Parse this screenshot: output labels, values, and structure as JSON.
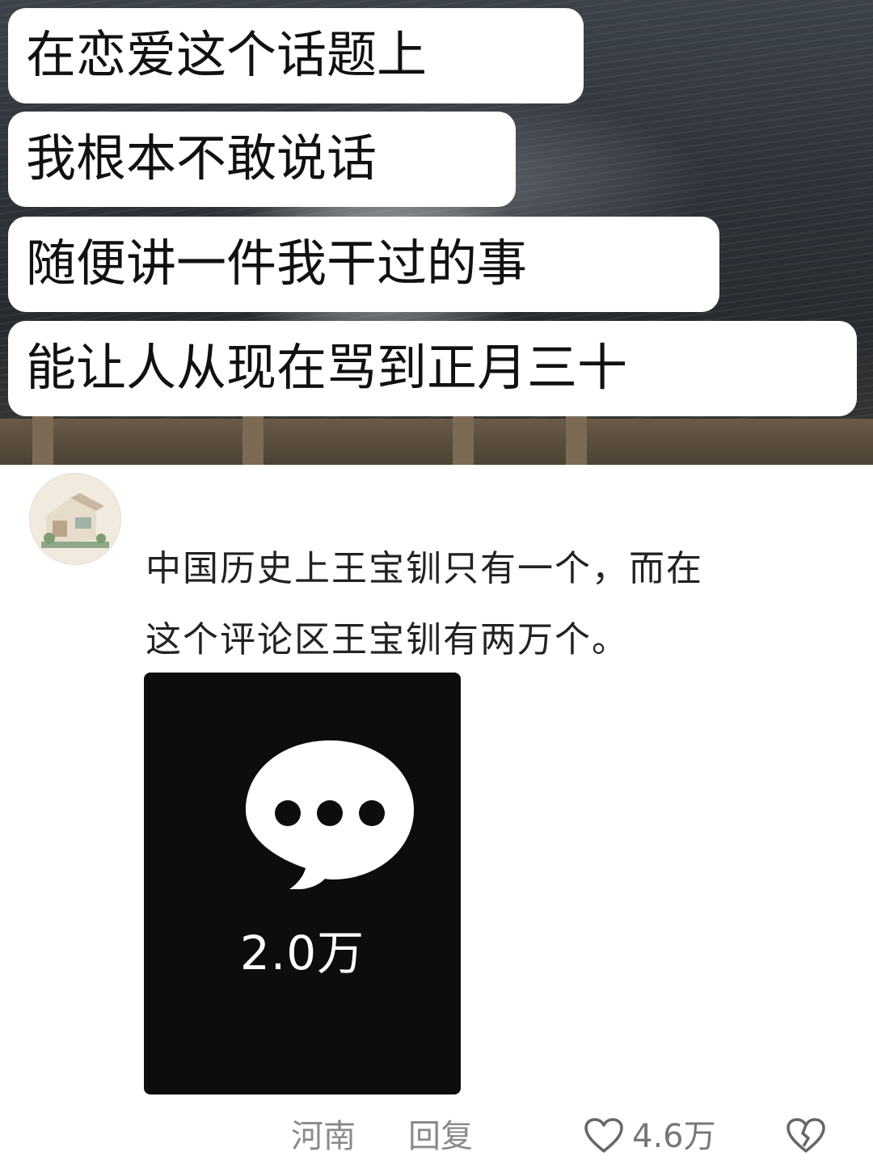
{
  "video_captions": [
    "在恋爱这个话题上",
    "我根本不敢说话",
    "随便讲一件我干过的事",
    "能让人从现在骂到正月三十"
  ],
  "comment": {
    "text_lines": [
      "中国历史上王宝钏只有一个，而在",
      "这个评论区王宝钏有两万个。"
    ],
    "image": {
      "comment_count_label": "2.0万",
      "bubble_icon": "chat-bubble-ellipsis-icon"
    },
    "footer": {
      "location": "河南",
      "reply_label": "回复",
      "like_count": "4.6万",
      "like_icon": "heart-outline-icon",
      "dislike_icon": "broken-heart-icon"
    }
  },
  "colors": {
    "caption_bg": "#ffffff",
    "caption_text": "#111111",
    "comment_text": "#222222",
    "meta_text": "#8a8a8a",
    "image_bg": "#0d0d0d"
  }
}
